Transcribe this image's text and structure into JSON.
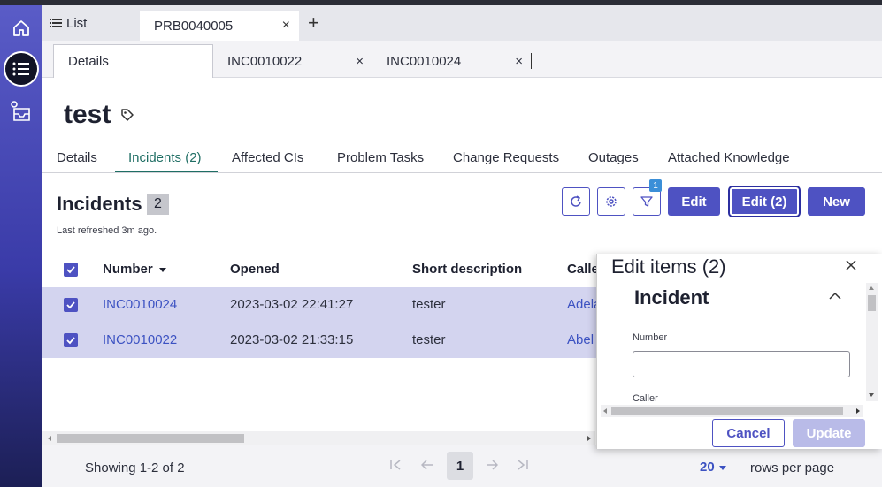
{
  "tabs": {
    "list_label": "List",
    "record_tab": "PRB0040005",
    "close_glyph": "×",
    "add_glyph": "+"
  },
  "subtabs": [
    {
      "label": "Details"
    },
    {
      "label": "INC0010022"
    },
    {
      "label": "INC0010024"
    }
  ],
  "record": {
    "title": "test"
  },
  "related_tabs": [
    {
      "label": "Details"
    },
    {
      "label": "Incidents (2)"
    },
    {
      "label": "Affected CIs"
    },
    {
      "label": "Problem Tasks"
    },
    {
      "label": "Change Requests"
    },
    {
      "label": "Outages"
    },
    {
      "label": "Attached Knowledge"
    }
  ],
  "list": {
    "title": "Incidents",
    "count": "2",
    "refreshed": "Last refreshed 3m ago.",
    "filter_count": "1",
    "buttons": {
      "edit": "Edit",
      "edit_selected": "Edit (2)",
      "new": "New"
    },
    "columns": {
      "number": "Number",
      "opened": "Opened",
      "short_description": "Short description",
      "caller": "Calle"
    },
    "rows": [
      {
        "number": "INC0010024",
        "opened": "2023-03-02 22:41:27",
        "short_description": "tester",
        "caller": "Adela"
      },
      {
        "number": "INC0010022",
        "opened": "2023-03-02 21:33:15",
        "short_description": "tester",
        "caller": "Abel"
      }
    ]
  },
  "footer": {
    "showing": "Showing 1-2 of 2",
    "page": "1",
    "rows_per_page_value": "20",
    "rows_per_page_label": "rows per page"
  },
  "edit_panel": {
    "title": "Edit items (2)",
    "section": "Incident",
    "number_label": "Number",
    "number_value": "",
    "caller_label": "Caller",
    "cancel": "Cancel",
    "update": "Update"
  },
  "colors": {
    "accent": "#4e52c2",
    "selected_row": "#d3d4ef",
    "active_tab": "#1f6e64",
    "link": "#3c52c2"
  },
  "icons": [
    "home-icon",
    "list-icon",
    "inbox-icon",
    "tag-icon",
    "refresh-icon",
    "gear-icon",
    "filter-icon",
    "sort-down-icon",
    "chevron-up-icon",
    "close-icon"
  ]
}
